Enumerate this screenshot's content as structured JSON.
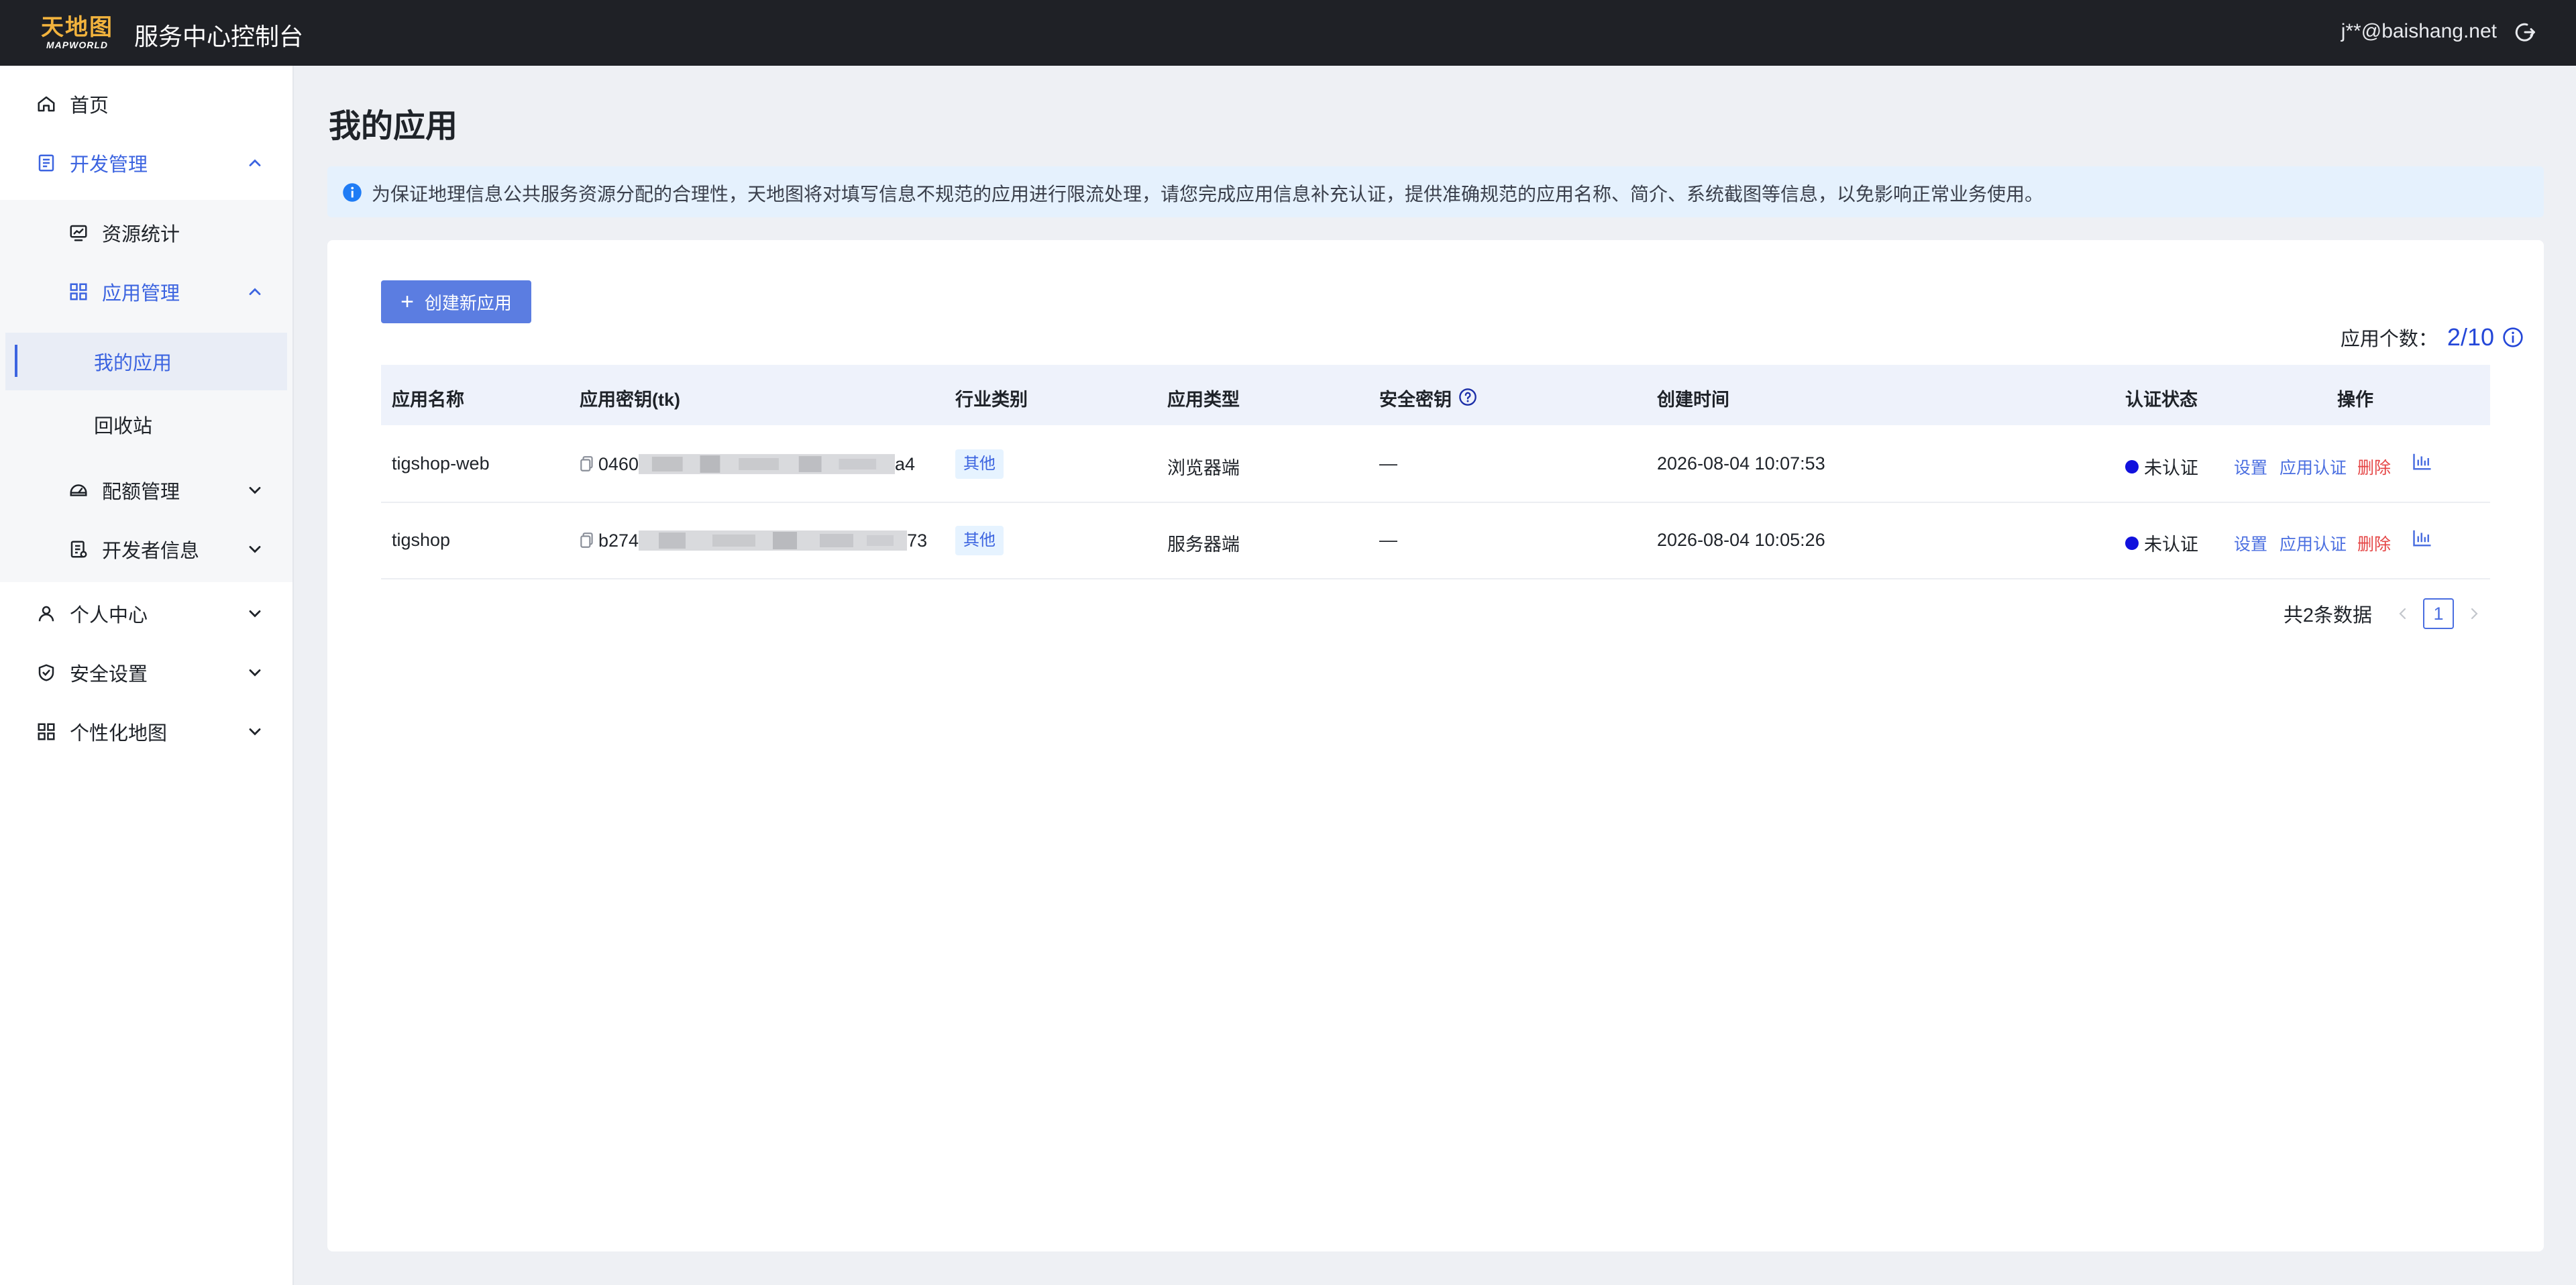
{
  "header": {
    "logo_cn": "天地图",
    "logo_en": "MAPWORLD",
    "title": "服务中心控制台",
    "user_email": "j**@baishang.net"
  },
  "sidebar": {
    "items": [
      {
        "label": "首页",
        "icon": "home-icon"
      },
      {
        "label": "开发管理",
        "icon": "document-icon",
        "expanded": true
      },
      {
        "label": "资源统计",
        "icon": "monitor-chart-icon"
      },
      {
        "label": "应用管理",
        "icon": "grid-icon",
        "expanded": true
      },
      {
        "label": "我的应用",
        "selected": true
      },
      {
        "label": "回收站"
      },
      {
        "label": "配额管理",
        "icon": "quota-icon"
      },
      {
        "label": "开发者信息",
        "icon": "developer-icon"
      },
      {
        "label": "个人中心",
        "icon": "user-icon"
      },
      {
        "label": "安全设置",
        "icon": "shield-icon"
      },
      {
        "label": "个性化地图",
        "icon": "apps-icon"
      }
    ]
  },
  "main": {
    "title": "我的应用",
    "notice": "为保证地理信息公共服务资源分配的合理性，天地图将对填写信息不规范的应用进行限流处理，请您完成应用信息补充认证，提供准确规范的应用名称、简介、系统截图等信息，以免影响正常业务使用。",
    "create_button": "创建新应用",
    "count_label": "应用个数：",
    "count_value": "2/10",
    "columns": [
      "应用名称",
      "应用密钥(tk)",
      "行业类别",
      "应用类型",
      "安全密钥",
      "创建时间",
      "认证状态",
      "操作"
    ],
    "rows": [
      {
        "name": "tigshop-web",
        "key_prefix": "0460",
        "key_suffix": "a4",
        "industry": "其他",
        "type": "浏览器端",
        "secret": "—",
        "created": "2026-08-04 10:07:53",
        "status": "未认证",
        "actions": [
          "设置",
          "应用认证",
          "删除"
        ]
      },
      {
        "name": "tigshop",
        "key_prefix": "b274",
        "key_suffix": "73",
        "industry": "其他",
        "type": "服务器端",
        "secret": "—",
        "created": "2026-08-04 10:05:26",
        "status": "未认证",
        "actions": [
          "设置",
          "应用认证",
          "删除"
        ]
      }
    ],
    "pagination": {
      "total_text": "共2条数据",
      "current_page": "1"
    }
  },
  "colors": {
    "topbar": "#1f2126",
    "accent": "#3c64e0",
    "button": "#5b7de1",
    "danger": "#e54545",
    "status_dot": "#1111dd",
    "notice_bg": "#e5f1fd"
  }
}
